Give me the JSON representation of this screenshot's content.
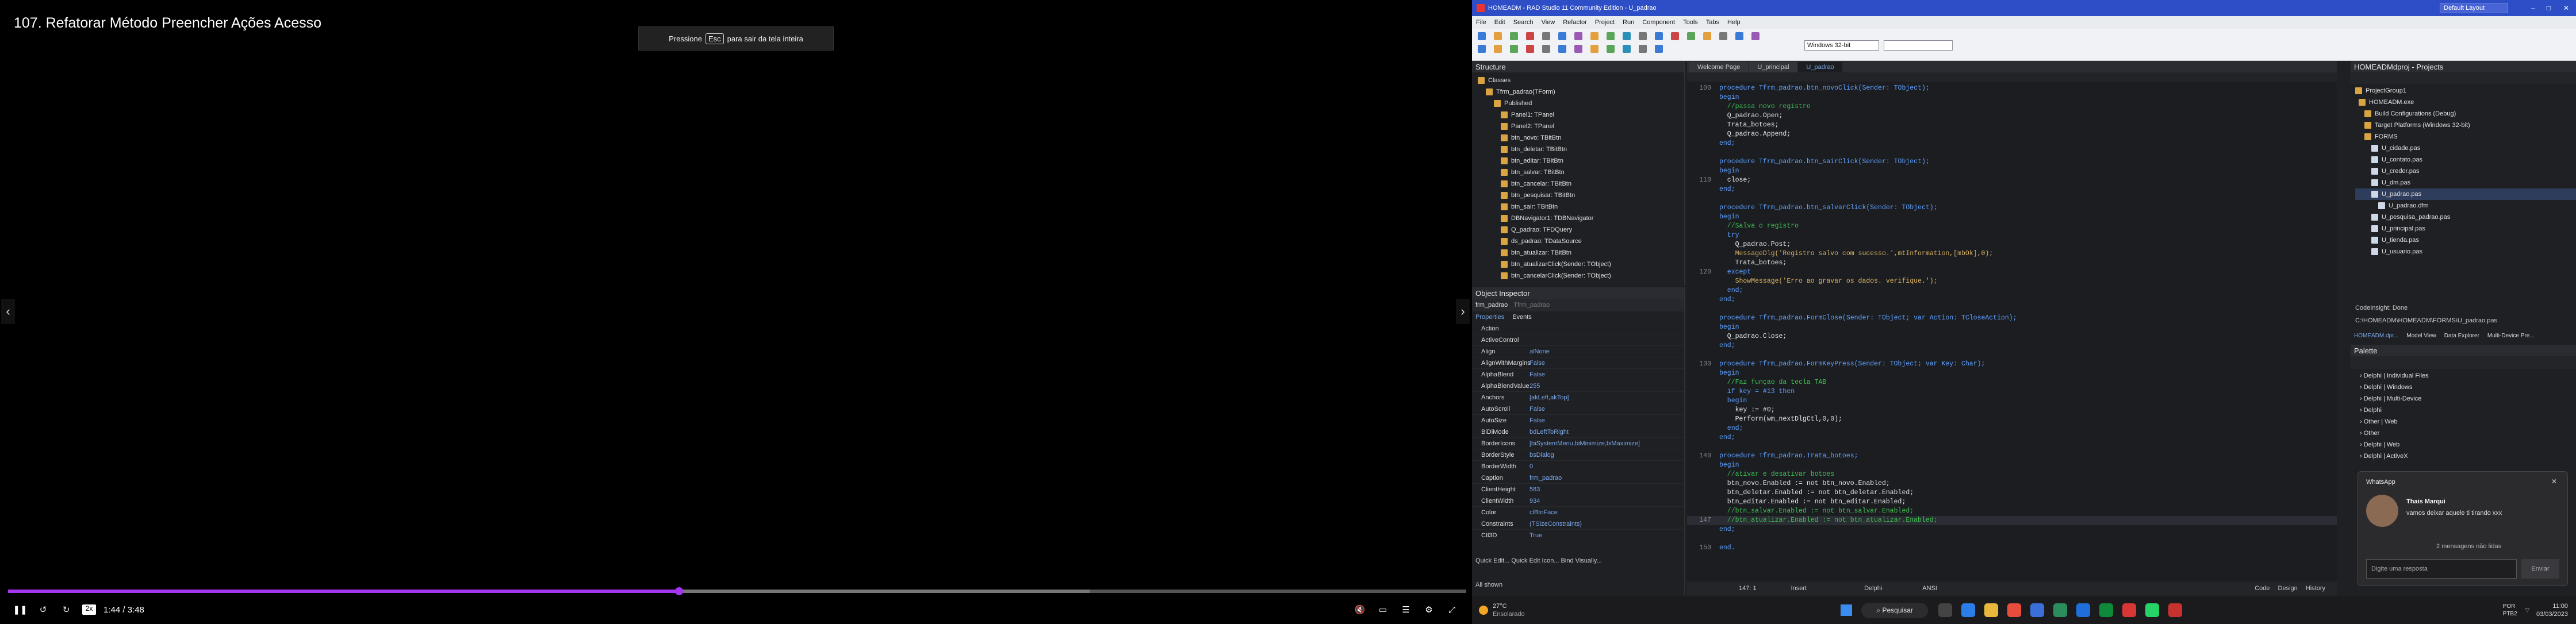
{
  "player": {
    "title": "107. Refatorar Método Preencher Ações Acesso",
    "esc_press": "Pressione",
    "esc_key": "Esc",
    "esc_rest": "para sair da tela inteira",
    "speed": "2x",
    "time": "1:44 / 3:48",
    "progress": 0.46
  },
  "ide": {
    "window_title": "HOMEADM - RAD Studio 11 Community Edition - U_padrao",
    "layout_select": "Default Layout",
    "menu": [
      "File",
      "Edit",
      "Search",
      "View",
      "Refactor",
      "Project",
      "Run",
      "Component",
      "Tools",
      "Tabs",
      "Help"
    ],
    "platform": "Windows 32-bit",
    "structure_title": "Structure",
    "structure_items": [
      "Classes",
      "Tfrm_padrao(TForm)",
      "Published",
      "Panel1: TPanel",
      "Panel2: TPanel",
      "btn_novo: TBitBtn",
      "btn_deletar: TBitBtn",
      "btn_editar: TBitBtn",
      "btn_salvar: TBitBtn",
      "btn_cancelar: TBitBtn",
      "btn_pesquisar: TBitBtn",
      "btn_sair: TBitBtn",
      "DBNavigator1: TDBNavigator",
      "Q_padrao: TFDQuery",
      "ds_padrao: TDataSource",
      "btn_atualizar: TBitBtn",
      "btn_atualizarClick(Sender: TObject)",
      "btn_cancelarClick(Sender: TObject)"
    ],
    "oi_title": "Object Inspector",
    "oi_object": "frm_padrao",
    "oi_object_type": "Tfrm_padrao",
    "oi_tab_props": "Properties",
    "oi_tab_events": "Events",
    "oi_rows": [
      {
        "k": "Action",
        "v": ""
      },
      {
        "k": "ActiveControl",
        "v": ""
      },
      {
        "k": "Align",
        "v": "alNone"
      },
      {
        "k": "AlignWithMargins",
        "v": "False"
      },
      {
        "k": "AlphaBlend",
        "v": "False"
      },
      {
        "k": "AlphaBlendValue",
        "v": "255"
      },
      {
        "k": "Anchors",
        "v": "[akLeft,akTop]"
      },
      {
        "k": "AutoScroll",
        "v": "False"
      },
      {
        "k": "AutoSize",
        "v": "False"
      },
      {
        "k": "BiDiMode",
        "v": "bdLeftToRight"
      },
      {
        "k": "BorderIcons",
        "v": "[biSystemMenu,biMinimize,biMaximize]"
      },
      {
        "k": "BorderStyle",
        "v": "bsDialog"
      },
      {
        "k": "BorderWidth",
        "v": "0"
      },
      {
        "k": "Caption",
        "v": "frm_padrao"
      },
      {
        "k": "ClientHeight",
        "v": "583"
      },
      {
        "k": "ClientWidth",
        "v": "934"
      },
      {
        "k": "Color",
        "v": "clBtnFace"
      },
      {
        "k": "Constraints",
        "v": "(TSizeConstraints)"
      },
      {
        "k": "Ctl3D",
        "v": "True"
      }
    ],
    "oi_footer": "Quick Edit...  Quick Edit Icon...  Bind Visually...",
    "oi_all_shown": "All shown",
    "tabs": [
      "Welcome Page",
      "U_principal",
      "U_padrao"
    ],
    "code": [
      {
        "n": "100",
        "t": "procedure Tfrm_padrao.btn_novoClick(Sender: TObject);",
        "c": "kw"
      },
      {
        "n": "",
        "t": "begin",
        "c": "kw"
      },
      {
        "n": "",
        "t": "  //passa novo registro",
        "c": "cm"
      },
      {
        "n": "",
        "t": "  Q_padrao.Open;",
        "c": ""
      },
      {
        "n": "",
        "t": "  Trata_botoes;",
        "c": ""
      },
      {
        "n": "",
        "t": "  Q_padrao.Append;",
        "c": ""
      },
      {
        "n": "",
        "t": "end;",
        "c": "kw"
      },
      {
        "n": "",
        "t": "",
        "c": ""
      },
      {
        "n": "",
        "t": "procedure Tfrm_padrao.btn_sairClick(Sender: TObject);",
        "c": "kw"
      },
      {
        "n": "",
        "t": "begin",
        "c": "kw"
      },
      {
        "n": "110",
        "t": "  close;",
        "c": ""
      },
      {
        "n": "",
        "t": "end;",
        "c": "kw"
      },
      {
        "n": "",
        "t": "",
        "c": ""
      },
      {
        "n": "",
        "t": "procedure Tfrm_padrao.btn_salvarClick(Sender: TObject);",
        "c": "kw"
      },
      {
        "n": "",
        "t": "begin",
        "c": "kw"
      },
      {
        "n": "",
        "t": "  //Salva o registro",
        "c": "cm"
      },
      {
        "n": "",
        "t": "  try",
        "c": "kw"
      },
      {
        "n": "",
        "t": "    Q_padrao.Post;",
        "c": ""
      },
      {
        "n": "",
        "t": "    MessageDlg('Registro salvo com sucesso.',mtInformation,[mbOk],0);",
        "c": "st"
      },
      {
        "n": "",
        "t": "    Trata_botoes;",
        "c": ""
      },
      {
        "n": "120",
        "t": "  except",
        "c": "kw"
      },
      {
        "n": "",
        "t": "    ShowMessage('Erro ao gravar os dados. verifique.');",
        "c": "st"
      },
      {
        "n": "",
        "t": "  end;",
        "c": "kw"
      },
      {
        "n": "",
        "t": "end;",
        "c": "kw"
      },
      {
        "n": "",
        "t": "",
        "c": ""
      },
      {
        "n": "",
        "t": "procedure Tfrm_padrao.FormClose(Sender: TObject; var Action: TCloseAction);",
        "c": "kw"
      },
      {
        "n": "",
        "t": "begin",
        "c": "kw"
      },
      {
        "n": "",
        "t": "  Q_padrao.Close;",
        "c": ""
      },
      {
        "n": "",
        "t": "end;",
        "c": "kw"
      },
      {
        "n": "",
        "t": "",
        "c": ""
      },
      {
        "n": "130",
        "t": "procedure Tfrm_padrao.FormKeyPress(Sender: TObject; var Key: Char);",
        "c": "kw"
      },
      {
        "n": "",
        "t": "begin",
        "c": "kw"
      },
      {
        "n": "",
        "t": "  //Faz funçao da tecla TAB",
        "c": "cm"
      },
      {
        "n": "",
        "t": "  if key = #13 then",
        "c": "kw"
      },
      {
        "n": "",
        "t": "  begin",
        "c": "kw"
      },
      {
        "n": "",
        "t": "    key := #0;",
        "c": ""
      },
      {
        "n": "",
        "t": "    Perform(wm_nextDlgCtl,0,0);",
        "c": ""
      },
      {
        "n": "",
        "t": "  end;",
        "c": "kw"
      },
      {
        "n": "",
        "t": "end;",
        "c": "kw"
      },
      {
        "n": "",
        "t": "",
        "c": ""
      },
      {
        "n": "140",
        "t": "procedure Tfrm_padrao.Trata_botoes;",
        "c": "kw"
      },
      {
        "n": "",
        "t": "begin",
        "c": "kw"
      },
      {
        "n": "",
        "t": "  //ativar e desativar botoes",
        "c": "cm"
      },
      {
        "n": "",
        "t": "  btn_novo.Enabled := not btn_novo.Enabled;",
        "c": ""
      },
      {
        "n": "",
        "t": "  btn_deletar.Enabled := not btn_deletar.Enabled;",
        "c": ""
      },
      {
        "n": "",
        "t": "  btn_editar.Enabled := not btn_editar.Enabled;",
        "c": ""
      },
      {
        "n": "",
        "t": "  //btn_salvar.Enabled := not btn_salvar.Enabled;",
        "c": "cm"
      },
      {
        "n": "147",
        "t": "  //btn_atualizar.Enabled := not btn_atualizar.Enabled;",
        "c": "cm"
      },
      {
        "n": "",
        "t": "end;",
        "c": "kw"
      },
      {
        "n": "",
        "t": "",
        "c": ""
      },
      {
        "n": "150",
        "t": "end.",
        "c": "kw"
      }
    ],
    "status_pos": "147: 1",
    "status_mode": "Insert",
    "status_lang": "Delphi",
    "status_enc": "ANSI",
    "status_tabs": [
      "Code",
      "Design",
      "History"
    ],
    "projects_title": "HOMEADMdproj - Projects",
    "projects": [
      "ProjectGroup1",
      "HOMEADM.exe",
      "Build Configurations (Debug)",
      "Target Platforms (Windows 32-bit)",
      "FORMS",
      "U_cidade.pas",
      "U_contato.pas",
      "U_credor.pas",
      "U_dm.pas",
      "U_padrao.pas",
      "U_padrao.dfm",
      "U_pesquisa_padrao.pas",
      "U_principal.pas",
      "U_tienda.pas",
      "U_usuario.pas"
    ],
    "codeinsight": "CodeInsight: Done",
    "path": "C:\\HOMEADM\\HOMEADM\\FORMS\\U_padrao.pas",
    "proj_tabs": [
      "HOMEADM.dpr...",
      "Model View",
      "Data Explorer",
      "Multi-Device Pre..."
    ],
    "palette_title": "Palette",
    "palette": [
      "Delphi | Individual Files",
      "Delphi | Windows",
      "Delphi | Multi-Device",
      "Delphi",
      "Other | Web",
      "Other",
      "Delphi | Web",
      "Delphi | ActiveX"
    ],
    "whatsapp_app": "WhatsApp",
    "whatsapp_name": "Thais Marqui",
    "whatsapp_msg": "vamos deixar aquele ti tirando xxx",
    "whatsapp_unread": "2 mensagens não lidas",
    "whatsapp_reply": "Digite uma resposta",
    "whatsapp_send": "Enviar"
  },
  "taskbar": {
    "temp": "27°C",
    "weather": "Ensolarado",
    "search": "Pesquisar",
    "lang": "POR",
    "lang2": "PTB2",
    "time": "11:00",
    "date": "03/03/2023"
  },
  "colors": {
    "accent": "#a435f0",
    "ide_title": "#2d4ec7"
  }
}
